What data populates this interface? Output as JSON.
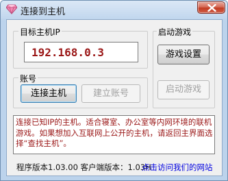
{
  "window": {
    "title": "连接到主机"
  },
  "target_host": {
    "legend": "目标主机IP",
    "ip_value": "192.168.0.3"
  },
  "account": {
    "legend": "账号",
    "connect_label": "连接主机",
    "create_account_label": "建立账号"
  },
  "launch_game": {
    "legend": "启动游戏",
    "settings_label": "游戏设置",
    "launch_label": "启动游戏"
  },
  "notice": {
    "text": "连接已知IP的主机。适合寝室、办公室等内网环境的联机游戏。如果想加入互联网上公开的主机，请返回主界面选择“查找主机”。"
  },
  "footer": {
    "version_text": "程序版本1.03.00 客户端版本：1.03H",
    "link_text": "点击访问我们的网站"
  },
  "colors": {
    "accent_text": "#9a1616",
    "link": "#0000e0",
    "close_button": "#c23b22"
  },
  "icons": {
    "app": "pink-diamond-icon",
    "close": "close-x-icon"
  }
}
